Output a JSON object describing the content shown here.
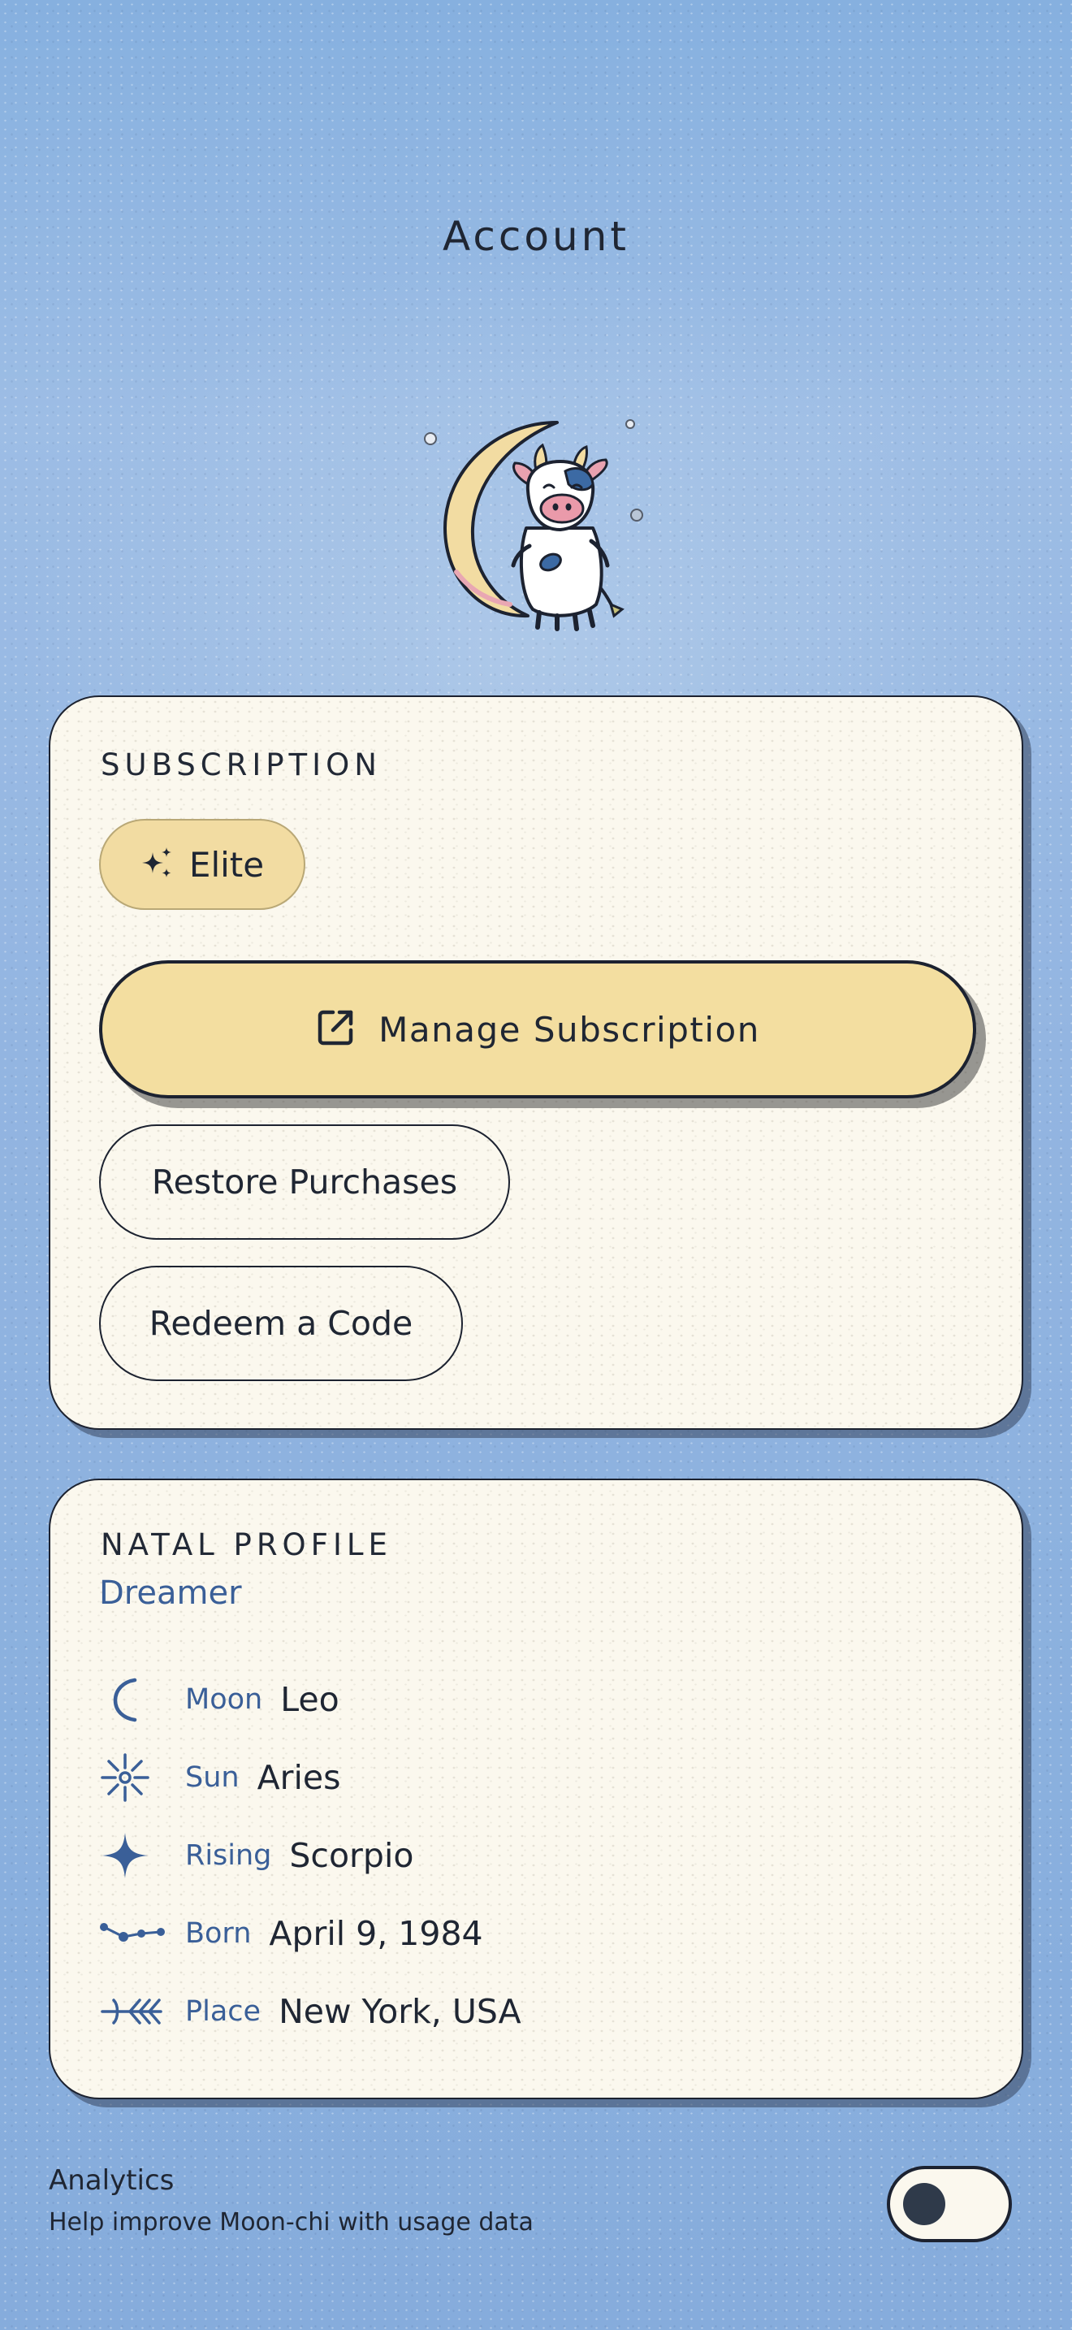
{
  "header": {
    "title": "Account"
  },
  "subscription": {
    "section_label": "SUBSCRIPTION",
    "tier": "Elite",
    "manage_label": "Manage Subscription",
    "restore_label": "Restore Purchases",
    "redeem_label": "Redeem a Code"
  },
  "natal": {
    "section_label": "NATAL PROFILE",
    "archetype": "Dreamer",
    "rows": [
      {
        "icon": "crescent-moon-icon",
        "key": "Moon",
        "value": "Leo"
      },
      {
        "icon": "sun-icon",
        "key": "Sun",
        "value": "Aries"
      },
      {
        "icon": "four-point-star-icon",
        "key": "Rising",
        "value": "Scorpio"
      },
      {
        "icon": "constellation-icon",
        "key": "Born",
        "value": "April 9, 1984"
      },
      {
        "icon": "arrow-icon",
        "key": "Place",
        "value": "New York, USA"
      }
    ]
  },
  "analytics": {
    "title": "Analytics",
    "description": "Help improve Moon-chi with usage data",
    "enabled": false
  },
  "colors": {
    "accent_yellow": "#f3dea0",
    "card_bg": "#fbf8ee",
    "label_blue": "#3a5f98",
    "ink": "#1c2230",
    "background": "#93b5e1"
  }
}
